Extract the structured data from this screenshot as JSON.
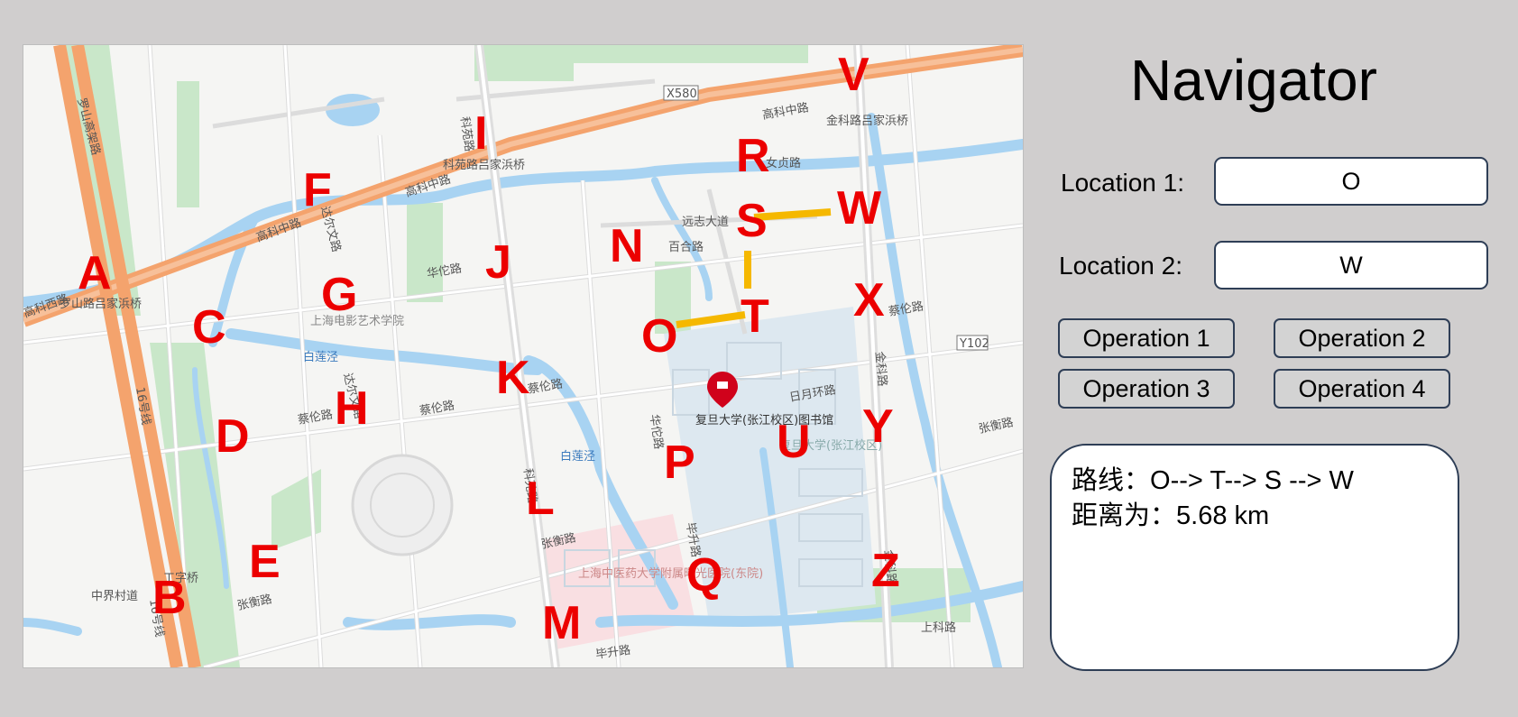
{
  "app": {
    "title": "Navigator"
  },
  "location1": {
    "label": "Location 1:",
    "value": "O"
  },
  "location2": {
    "label": "Location 2:",
    "value": "W"
  },
  "operations": [
    "Operation 1",
    "Operation 2",
    "Operation 3",
    "Operation 4"
  ],
  "result": {
    "route_label": "路线：",
    "route_value": "O--> T--> S --> W",
    "distance_label": "距离为：",
    "distance_value": "5.68 km"
  },
  "map": {
    "node_labels": [
      "A",
      "B",
      "C",
      "D",
      "E",
      "F",
      "G",
      "H",
      "I",
      "J",
      "K",
      "L",
      "M",
      "N",
      "O",
      "P",
      "Q",
      "R",
      "S",
      "T",
      "U",
      "V",
      "W",
      "X",
      "Y",
      "Z"
    ],
    "route_color": "#f5b800",
    "label_color": "#ec0000",
    "road_names": {
      "gaoke_west": "高科西路",
      "gaoke_middle": "高科中路",
      "gaoke_east": "高科中路",
      "luoshan": "罗山高架路",
      "line16": "16号线",
      "keyuan": "科苑路",
      "huatuo": "华佗路",
      "cailun": "蔡伦路",
      "zhangheng": "张衡路",
      "darwin": "达尔文路",
      "bilianjing": "白莲泾",
      "bisheng": "毕升路",
      "jinke": "金科路",
      "yuanzhi": "远志大道",
      "baihe": "百合路",
      "nvzhen": "女贞路",
      "riyue": "日月环路",
      "jinke_jiabang": "金科路吕家浜桥",
      "keyuan_jiabang": "科苑路吕家浜桥",
      "luoshan_jiabang": "罗山路吕家浜桥",
      "library": "复旦大学(张江校区)图书馆",
      "campus": "复旦大学(张江校区)",
      "hospital": "上海中医药大学附属曙光医院(东院)",
      "film_academy": "上海电影艺术学院",
      "x580": "X580",
      "y102": "Y102",
      "changzheng_bridge": "工字桥",
      "zhongjie": "中界村道",
      "shangke": "上科路"
    }
  }
}
